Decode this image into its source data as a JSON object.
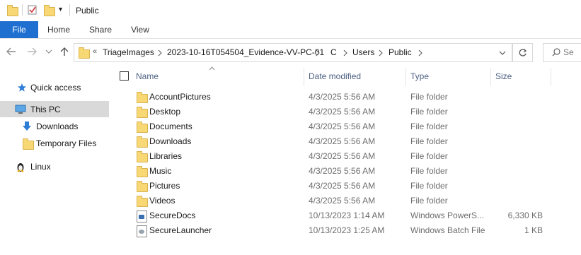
{
  "window": {
    "title": "Public"
  },
  "quick_access_toolbar": {
    "dropdown_glyph": "▾"
  },
  "ribbon": {
    "tabs": [
      {
        "label": "File"
      },
      {
        "label": "Home"
      },
      {
        "label": "Share"
      },
      {
        "label": "View"
      }
    ]
  },
  "address_bar": {
    "overflow": "«",
    "breadcrumbs": [
      "TriageImages",
      "2023-10-16T054504_Evidence-VV-PC-01",
      "C",
      "Users",
      "Public"
    ],
    "search_placeholder": "Se"
  },
  "nav_pane": {
    "items": [
      {
        "label": "Quick access",
        "icon": "star-icon"
      },
      {
        "label": "This PC",
        "icon": "computer-icon",
        "selected": true
      },
      {
        "label": "Downloads",
        "icon": "download-arrow-icon"
      },
      {
        "label": "Temporary Files",
        "icon": "folder-icon"
      },
      {
        "label": "Linux",
        "icon": "penguin-icon"
      }
    ]
  },
  "file_list": {
    "columns": {
      "name": "Name",
      "date": "Date modified",
      "type": "Type",
      "size": "Size"
    },
    "rows": [
      {
        "name": "AccountPictures",
        "date": "4/3/2025 5:56 AM",
        "type": "File folder",
        "size": "",
        "icon": "folder-icon"
      },
      {
        "name": "Desktop",
        "date": "4/3/2025 5:56 AM",
        "type": "File folder",
        "size": "",
        "icon": "folder-icon"
      },
      {
        "name": "Documents",
        "date": "4/3/2025 5:56 AM",
        "type": "File folder",
        "size": "",
        "icon": "folder-icon"
      },
      {
        "name": "Downloads",
        "date": "4/3/2025 5:56 AM",
        "type": "File folder",
        "size": "",
        "icon": "folder-icon"
      },
      {
        "name": "Libraries",
        "date": "4/3/2025 5:56 AM",
        "type": "File folder",
        "size": "",
        "icon": "folder-icon"
      },
      {
        "name": "Music",
        "date": "4/3/2025 5:56 AM",
        "type": "File folder",
        "size": "",
        "icon": "folder-icon"
      },
      {
        "name": "Pictures",
        "date": "4/3/2025 5:56 AM",
        "type": "File folder",
        "size": "",
        "icon": "folder-icon"
      },
      {
        "name": "Videos",
        "date": "4/3/2025 5:56 AM",
        "type": "File folder",
        "size": "",
        "icon": "folder-icon"
      },
      {
        "name": "SecureDocs",
        "date": "10/13/2023 1:14 AM",
        "type": "Windows PowerS...",
        "size": "6,330 KB",
        "icon": "powershell-script-icon"
      },
      {
        "name": "SecureLauncher",
        "date": "10/13/2023 1:25 AM",
        "type": "Windows Batch File",
        "size": "1 KB",
        "icon": "batch-file-icon"
      }
    ]
  },
  "colors": {
    "accent": "#1f6fd0",
    "folder": "#f8d775",
    "selected_nav": "#d9d9d9",
    "header_text": "#4d6082"
  }
}
